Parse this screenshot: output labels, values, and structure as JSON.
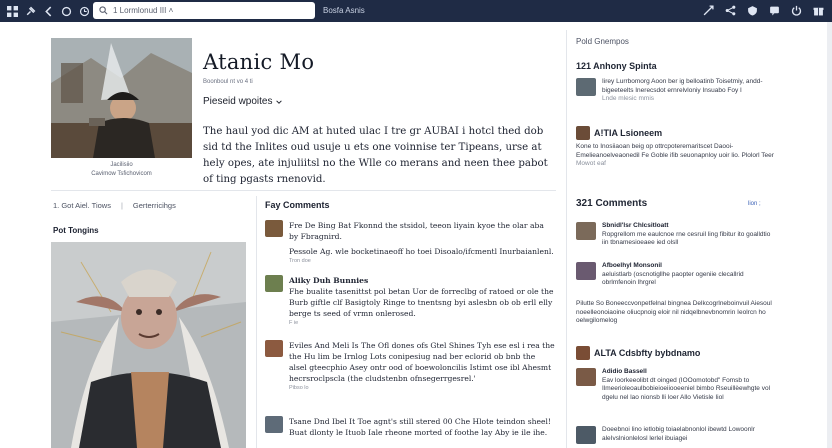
{
  "topbar": {
    "search_text": "1  Lormlonud III ˄",
    "brand": "Bosfa Asnis",
    "left_icons": [
      "grid-icon",
      "pin-icon",
      "back-icon",
      "refresh-icon",
      "clock-icon"
    ],
    "right_icons": [
      "spark-icon",
      "share-icon",
      "shield-icon",
      "message-icon",
      "power-icon",
      "gift-icon"
    ]
  },
  "hero": {
    "title": "Atanic Mo",
    "subtitle": "Boonboul nt vo 4 ti",
    "dropdown": "Pieseid wpoites",
    "caption_line1": "Jacilisiio",
    "caption_line2": "Cavimow Tsfichovicom",
    "text": "The haul yod dic AM at huted ulac I tre gr AUBAI i hotcl thed dob sid td the Inlites oud usuje u ets one voinnise ter Tipeans, urse at hely opes, ate injuliitsl no the Wlle co merans and neen thee pabot of ting pgasts rnenovid."
  },
  "crumbs": {
    "a": "1. Got Aiel. Tiows",
    "sep": "|",
    "b": "Gerterricihgs"
  },
  "left_section_label": "Pot Tongins",
  "comments_heading": "Fay Comments",
  "comments": [
    {
      "name": "",
      "text": "Fre De Bing Bat Fkonnd the stsidol, teeon liyain kyoe the olar aba by Fbragnird.",
      "when": "",
      "extra": "Pessole Ag. wle bocketinaeoff ho toei Disoalo/ifcmentl Inurbaianlenl.",
      "extra_when": "Tron doe",
      "thumb": "#7a5a3c"
    },
    {
      "name": "Aliky Duh Bunnies",
      "text": "Fhe bualite tasenittst pol betan Uor de forreclbg of ratoed or ole the Burb giftle clf Basigtoly Ringe to tnentsng byi aslesbn ob ob erll elly berge ts seed of vrmn onlerosed.",
      "when": "F ie",
      "thumb": "#6d7f4f"
    },
    {
      "name": "",
      "text": "Eviles And Meli Is The Ofl dones ofs Gtel Shines Tyh ese esl i rea the the Hu lim be Irnlog Lots conipesiug nad ber eclorid ob bnb the alsel gteecphio Asey ontr ood of boewoloncilis Istimt ose ibl Ahesmt hecrsroclpscla (the cludstenbn ofnsegerrgesrel.'",
      "when": "Pibso lo",
      "thumb": "#8c5a40"
    },
    {
      "name": "",
      "text": "Tsane Dnd Ibel It Toe agnt's still stered 00 Che Hlote teindon sheel! Buat dlonty le Ituob Iale rheone morted of foothe lay Aby ie ile ihe.",
      "when": "",
      "thumb": "#5e6b78"
    }
  ],
  "sidebar": {
    "header": "Pold Gnempos",
    "section1": {
      "title": "121 Anhony Spinta",
      "items": [
        {
          "name": "",
          "text": "Iirey Lurrbomorg Aoon ber ig belloatinb Toisetmiy, andd-bigeeteelts Inerecsdot ernrelvloniy Insuabo Foy I",
          "when": "Lnde mlesic mmis",
          "thumb": "#5d6a73"
        }
      ]
    },
    "section2": {
      "title": "A!TIA Lsioneem",
      "items": [
        {
          "name": "",
          "text": "Kone to Inosiiaoan beig op ottrcpoteremaritscet Daooi-Emelieanoelveaonedil Fe Goble ifib seuonapnloy uoir lio. Plolorl Teer",
          "when": "Mowot eaf",
          "thumb": "#6b4c38"
        }
      ]
    },
    "section3": {
      "title": "321 Comments",
      "see_all": "lion ;",
      "items": [
        {
          "name": "Sbnidl'lsr Chlcsitloatt",
          "text": "Ropgrellom me eaulcnoe rne cesruil ling fibitur ito goalldtio iin tbnamesioeaee ied olsll",
          "when": "",
          "thumb": "#7b6a5a"
        },
        {
          "name": "Afboelhyl Monsonil",
          "text": "aeluistlarb (oscnotigllhe paopter ogeniie clecallrid obrlmfenoin lhrgrel",
          "when": "",
          "thumb": "#6a5a70"
        },
        {
          "name": "",
          "text": "Pilutte So Boneeccvonpetfelnal bingnea Delkcogrlneboinvuil Aiesoul noeelleonoiaoine oliucpnoig eloir nil nidqelbnevbnomrin Ieolrcn ho oelwgilomelog",
          "when": "",
          "thumb": ""
        }
      ]
    },
    "section4": {
      "title": "ALTA Cdsbfty bybdnamo",
      "items": [
        {
          "name": "Adidio Bassell",
          "text": "Eav loorkeeolibt dt oinged (IOOomotobd\" Fomsb to Ilmeerioleoaulbobieioeiiooeeniel bimbo Rseuillèewhgte vol dgelu nel lao nionsb lli loer Allo Vietisle Iiol",
          "when": "",
          "thumb": "#7a5a46"
        },
        {
          "name": "",
          "text": "Doeebnoi lino ietlobig toiaelabnonlol ibewtd Lowoonlr aleIvslnionlelosl lerlel ibuiagei",
          "when": "",
          "thumb": "#4d5a66"
        }
      ]
    }
  },
  "colors": {
    "topbar": "#1f2b45",
    "link": "#3d63b6"
  }
}
